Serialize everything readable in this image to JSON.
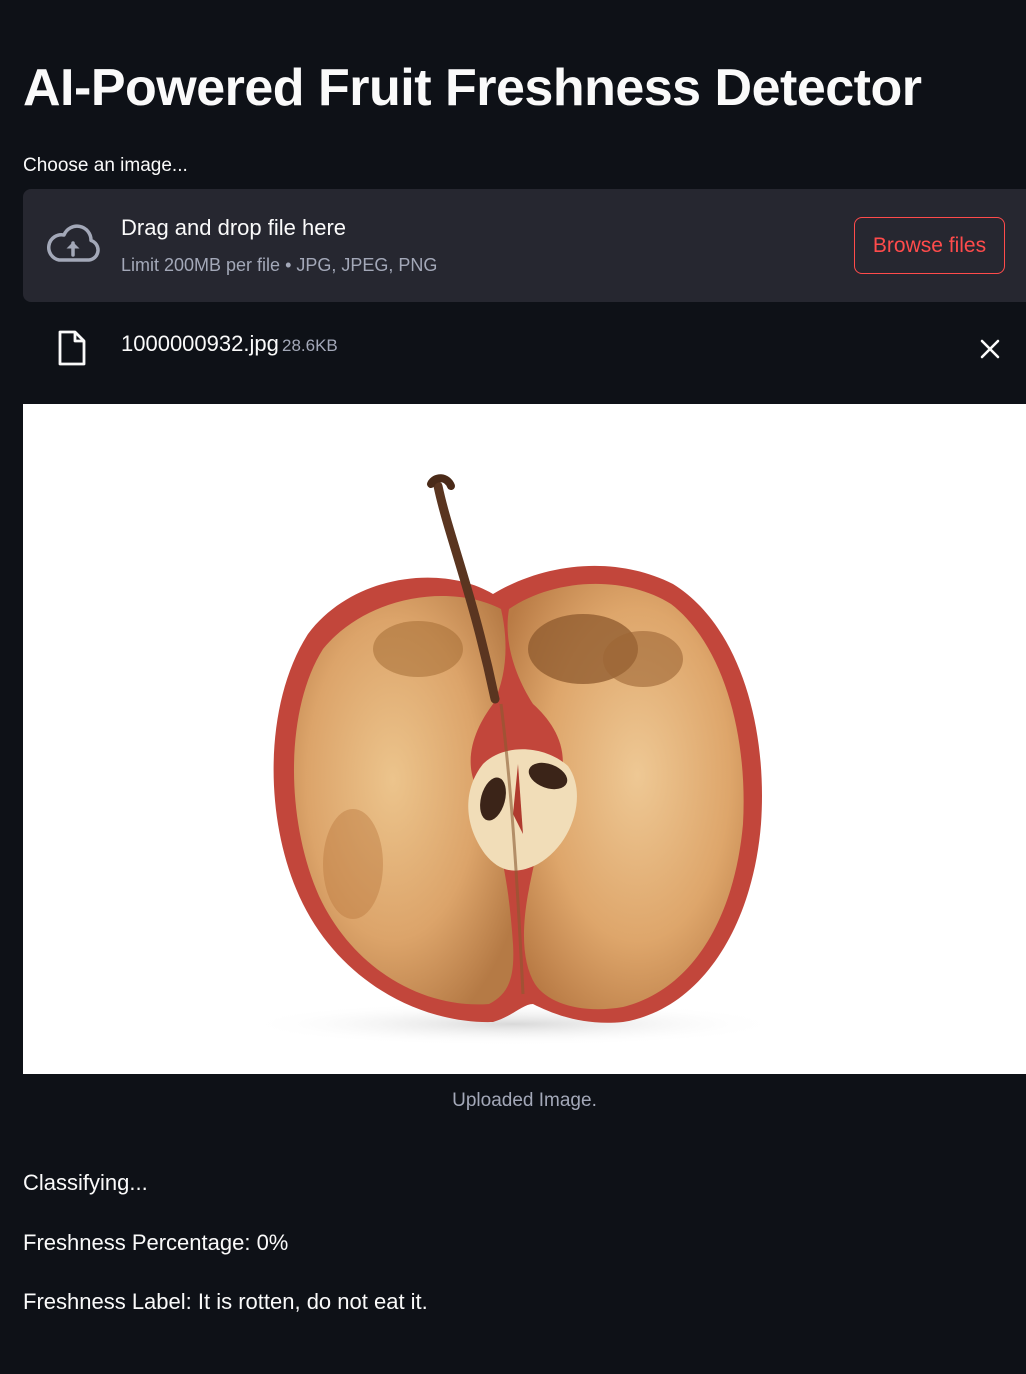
{
  "app": {
    "title": "AI-Powered Fruit Freshness Detector"
  },
  "uploader": {
    "label": "Choose an image...",
    "drop_title": "Drag and drop file here",
    "drop_subtitle": "Limit 200MB per file • JPG, JPEG, PNG",
    "browse_label": "Browse files",
    "icon": "cloud-upload-icon"
  },
  "uploaded_file": {
    "name": "1000000932.jpg",
    "size": "28.6KB",
    "icon": "file-icon",
    "remove_icon": "close-icon"
  },
  "image": {
    "caption": "Uploaded Image."
  },
  "results": {
    "status": "Classifying...",
    "percentage_text": "Freshness Percentage: 0%",
    "label_text": "Freshness Label: It is rotten, do not eat it."
  },
  "colors": {
    "background": "#0e1117",
    "surface": "#262730",
    "accent": "#ff4b4b",
    "text": "#fafafa",
    "muted_text": "#a3a8b8"
  }
}
